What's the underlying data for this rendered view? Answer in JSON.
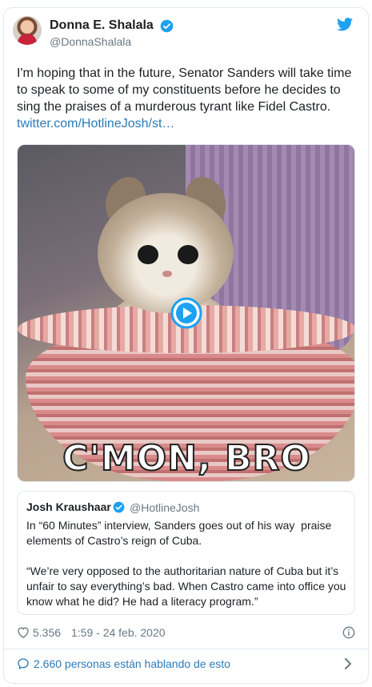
{
  "colors": {
    "link": "#2b7bb9",
    "verified": "#1da1f2",
    "muted": "#697882",
    "text": "#1c2022",
    "border": "#e1e8ed"
  },
  "tweet": {
    "author_name": "Donna E. Shalala",
    "author_handle": "@DonnaShalala",
    "text": "I'm hoping that in the future, Senator Sanders will take time to speak to some of my constituents before he decides to sing the praises of a murderous tyrant like Fidel Castro.",
    "link": "twitter.com/HotlineJosh/st…",
    "media": {
      "caption": "C'MON, BRO",
      "play_icon": "play-icon"
    },
    "quoted": {
      "author_name": "Josh Kraushaar",
      "author_handle": "@HotlineJosh",
      "text": "In “60 Minutes” interview, Sanders goes out of his way  praise elements of Castro’s reign of Cuba.\n\n“We’re very opposed to the authoritarian nature of Cuba but it’s unfair to say everything’s bad. When Castro came into office you know what he did? He had a literacy program.”"
    },
    "like_count": "5.356",
    "timestamp": "1:59 - 24 feb. 2020",
    "footer_text": "2.660 personas están hablando de esto"
  },
  "icons": {
    "brand": "twitter-bird-icon",
    "verified": "verified-badge-icon",
    "like": "heart-icon",
    "info": "info-icon",
    "reply": "speech-bubble-icon",
    "more": "chevron-right-icon"
  }
}
